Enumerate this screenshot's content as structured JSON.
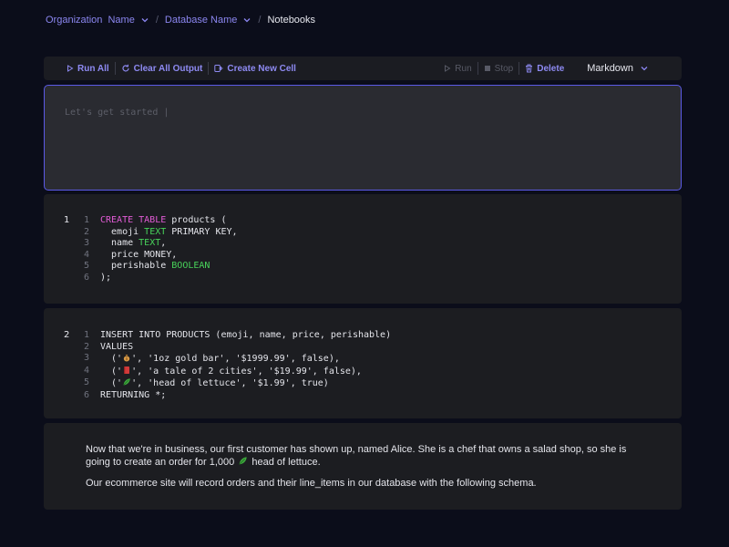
{
  "breadcrumb": {
    "org": "Organization  Name",
    "db": "Database Name",
    "sep1": "/",
    "sep2": "/",
    "current": "Notebooks"
  },
  "toolbar": {
    "run_all": "Run All",
    "clear_all": "Clear All Output",
    "create_cell": "Create New Cell",
    "run": "Run",
    "stop": "Stop",
    "delete": "Delete",
    "cell_type": "Markdown"
  },
  "input_cell": {
    "placeholder": "Let's get started |"
  },
  "cells": [
    {
      "number": "1",
      "lines": [
        {
          "n": "1"
        },
        {
          "n": "2"
        },
        {
          "n": "3"
        },
        {
          "n": "4"
        },
        {
          "n": "5"
        },
        {
          "n": "6"
        }
      ],
      "tokens": {
        "l1_kw": "CREATE TABLE",
        "l1_rest": " products (",
        "l2_a": "  emoji ",
        "l2_ty": "TEXT",
        "l2_b": " PRIMARY KEY,",
        "l3_a": "  name ",
        "l3_ty": "TEXT",
        "l3_b": ",",
        "l4": "  price MONEY,",
        "l5_a": "  perishable ",
        "l5_ty": "BOOLEAN",
        "l6": ");"
      }
    },
    {
      "number": "2",
      "tokens": {
        "l1": "INSERT INTO PRODUCTS (emoji, name, price, perishable)",
        "l2": "VALUES",
        "l3_a": "  ('",
        "l3_b": "', '1oz gold bar', '$1999.99', false),",
        "l4_a": "  ('",
        "l4_b": "', 'a tale of 2 cities', '$19.99', false),",
        "l5_a": "  ('",
        "l5_b": "', 'head of lettuce', '$1.99', true)",
        "l6": "RETURNING *;"
      }
    }
  ],
  "markdown": {
    "p1_a": "Now that we're in business, our first customer has shown up, named Alice. She is a chef that owns a salad shop, so she is going to create an order for 1,000 ",
    "p1_b": " head of lettuce.",
    "p2": "Our ecommerce site will record orders and their line_items in our database with the following schema."
  },
  "colors": {
    "accent": "#8b86f0",
    "focus_border": "#5b5ae6",
    "keyword": "#e15bd5",
    "type": "#48d35a"
  }
}
